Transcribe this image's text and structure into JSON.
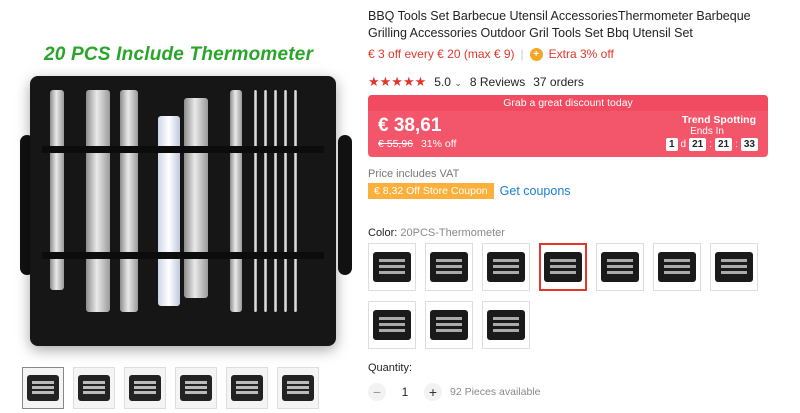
{
  "gallery": {
    "headline": "20 PCS Include Thermometer",
    "thumbnails": [
      "thumb-1",
      "thumb-2",
      "thumb-3",
      "thumb-4",
      "thumb-5",
      "thumb-6"
    ]
  },
  "product": {
    "title": "BBQ Tools Set Barbecue Utensil AccessoriesThermometer Barbeque Grilling Accessories Outdoor Gril Tools Set Bbq Utensil Set",
    "promo_discount": "€ 3 off every € 20 (max € 9)",
    "promo_extra": "Extra 3% off",
    "stars": "★★★★★",
    "rating": "5.0",
    "reviews": "8 Reviews",
    "orders": "37 orders"
  },
  "deal": {
    "banner": "Grab a great discount today",
    "price": "€ 38,61",
    "old_price": "€ 55,96",
    "discount": "31% off",
    "trend": "Trend Spotting",
    "ends_in": "Ends In",
    "timer": {
      "days": "1",
      "d_label": "d",
      "hours": "21",
      "minutes": "21",
      "seconds": "33"
    }
  },
  "vat_note": "Price includes VAT",
  "coupon": {
    "badge": "€ 8,32 Off Store Coupon",
    "link": "Get coupons"
  },
  "color": {
    "label": "Color:",
    "selected": "20PCS-Thermometer"
  },
  "quantity": {
    "label": "Quantity:",
    "minus": "−",
    "value": "1",
    "plus": "+",
    "available": "92 Pieces available"
  },
  "colors": {
    "accent": "#e2362a",
    "deal_bg": "#f3566a",
    "coupon": "#fbb03b",
    "link": "#1a7fd4",
    "headline": "#29a52a"
  }
}
